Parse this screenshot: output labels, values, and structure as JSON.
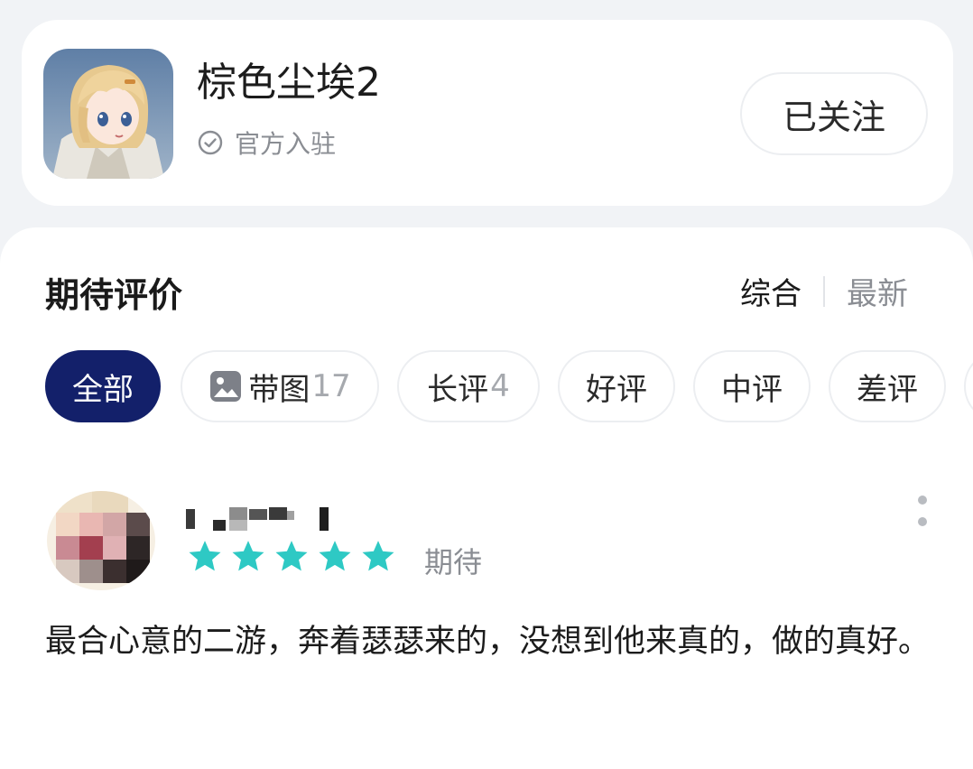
{
  "app": {
    "title": "棕色尘埃2",
    "verified_label": "官方入驻",
    "follow_label": "已关注",
    "icon": "app-icon-anime-girl"
  },
  "reviews_section": {
    "title": "期待评价",
    "sort": {
      "active": "综合",
      "inactive": "最新"
    },
    "filters": [
      {
        "label": "全部",
        "count": "",
        "active": true
      },
      {
        "label": "带图",
        "count": "17",
        "icon": "image-icon"
      },
      {
        "label": "长评",
        "count": "4"
      },
      {
        "label": "好评",
        "count": ""
      },
      {
        "label": "中评",
        "count": ""
      },
      {
        "label": "差评",
        "count": ""
      }
    ]
  },
  "review": {
    "rating": 5,
    "rating_max": 5,
    "tag": "期待",
    "text": "最合心意的二游，奔着瑟瑟来的，没想到他来真的，做的真好。"
  },
  "colors": {
    "accent": "#13206a",
    "star": "#2ec9c4",
    "muted": "#8a8d93"
  }
}
